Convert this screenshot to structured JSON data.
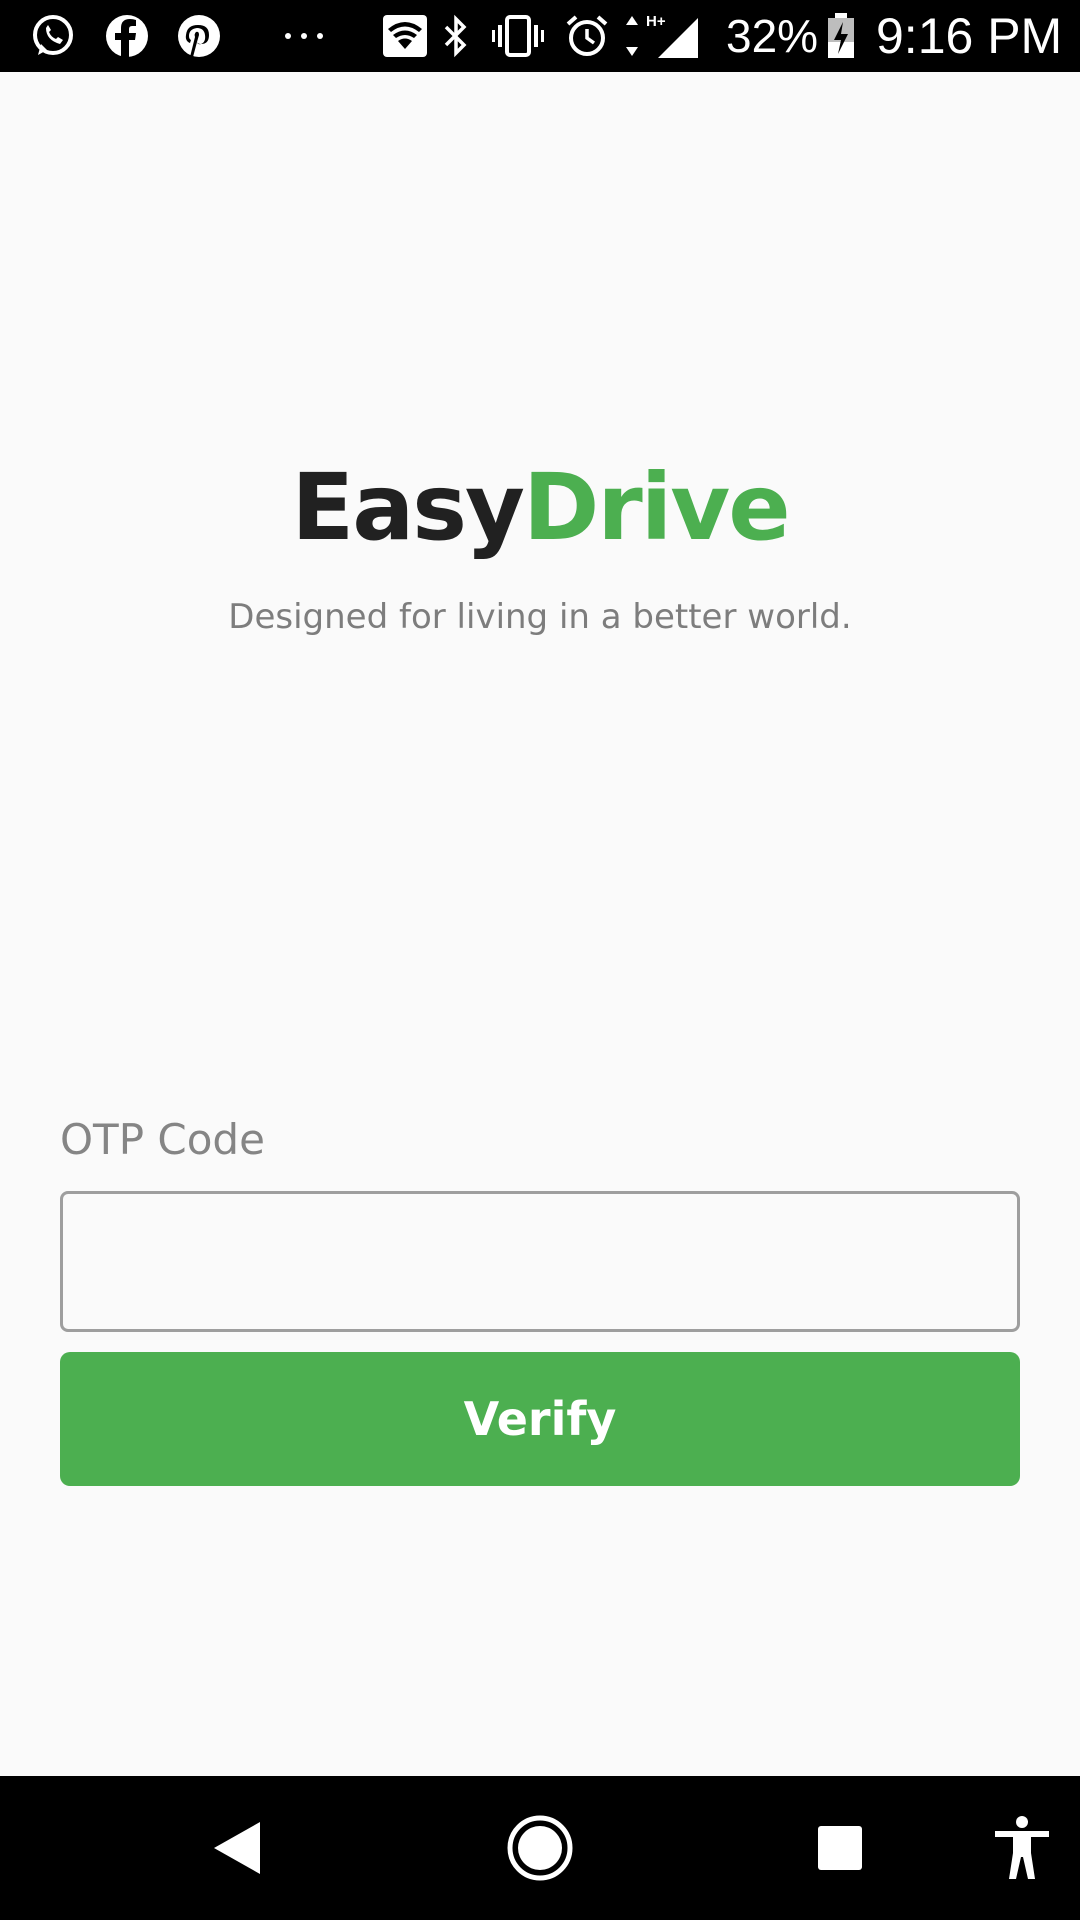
{
  "status_bar": {
    "left_icons": [
      "whatsapp-icon",
      "facebook-icon",
      "pinterest-icon",
      "more-notifications-icon"
    ],
    "right_icons": [
      "wifi-icon",
      "bluetooth-icon",
      "vibrate-icon",
      "alarm-icon",
      "mobile-data-icon",
      "signal-icon",
      "battery-icon"
    ],
    "network_type": "H+",
    "battery_percent": "32%",
    "time": "9:16 PM"
  },
  "branding": {
    "logo_part1": "Easy",
    "logo_part2": "Drive",
    "tagline": "Designed for living in a better world."
  },
  "form": {
    "otp_label": "OTP Code",
    "otp_value": "",
    "verify_label": "Verify"
  },
  "nav_bar": {
    "buttons": [
      "back-icon",
      "home-icon",
      "recents-icon",
      "accessibility-icon"
    ]
  },
  "colors": {
    "accent": "#4caf50",
    "logo_dark": "#212121",
    "background": "#fafafa",
    "system_bars": "#000000"
  }
}
